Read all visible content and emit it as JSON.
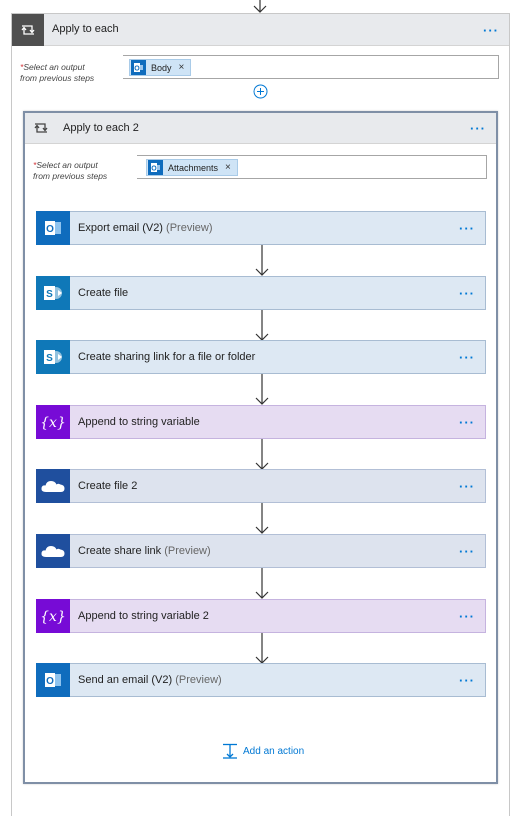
{
  "outer_loop": {
    "title": "Apply to each",
    "menu": "···",
    "select_label_req": "*",
    "select_label_line1": "Select an output",
    "select_label_line2": "from previous steps",
    "token_label": "Body",
    "token_remove": "×",
    "icon": "loop-icon"
  },
  "inner_loop": {
    "title": "Apply to each 2",
    "menu": "···",
    "select_label_req": "*",
    "select_label_line1": "Select an output",
    "select_label_line2": "from previous steps",
    "token_label": "Attachments",
    "token_remove": "×",
    "icon": "loop-icon"
  },
  "actions": [
    {
      "label": "Export email (V2)",
      "suffix": "(Preview)",
      "icon": "outlook-icon",
      "color": "#0f6cbd",
      "menu": "···"
    },
    {
      "label": "Create file",
      "suffix": "",
      "icon": "sharepoint-icon",
      "color": "#0f78b8",
      "menu": "···"
    },
    {
      "label": "Create sharing link for a file or folder",
      "suffix": "",
      "icon": "sharepoint-icon",
      "color": "#0f78b8",
      "menu": "···"
    },
    {
      "label": "Append to string variable",
      "suffix": "",
      "icon": "variable-icon",
      "color": "#770bd6",
      "menu": "···"
    },
    {
      "label": "Create file 2",
      "suffix": "",
      "icon": "onedrive-icon",
      "color": "#1f4f9e",
      "menu": "···"
    },
    {
      "label": "Create share link",
      "suffix": "(Preview)",
      "icon": "onedrive-icon",
      "color": "#1f4f9e",
      "menu": "···"
    },
    {
      "label": "Append to string variable 2",
      "suffix": "",
      "icon": "variable-icon",
      "color": "#770bd6",
      "menu": "···"
    },
    {
      "label": "Send an email (V2)",
      "suffix": "(Preview)",
      "icon": "outlook-icon",
      "color": "#0f6cbd",
      "menu": "···"
    }
  ],
  "add_action": {
    "label": "Add an action",
    "icon": "add-action-icon"
  },
  "colors": {
    "accent": "#0078d4",
    "loop_icon_bg": "#4f4f4f",
    "required": "#d13438"
  }
}
